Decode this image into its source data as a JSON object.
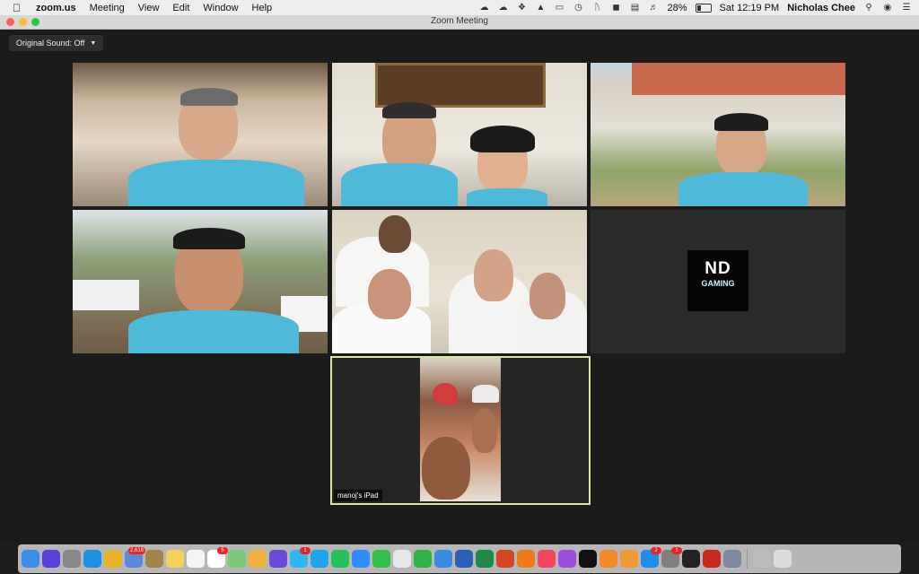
{
  "menubar": {
    "app_name": "zoom.us",
    "menus": [
      "Meeting",
      "View",
      "Edit",
      "Window",
      "Help"
    ],
    "battery": "28%",
    "clock": "Sat 12:19 PM",
    "user": "Nicholas Chee",
    "status_icons": [
      "creative-cloud-icon",
      "cloud-icon",
      "dropbox-icon",
      "backup-icon",
      "airplay-icon",
      "time-machine-icon",
      "bluetooth-icon",
      "wifi-icon",
      "display-icon",
      "volume-icon",
      "battery-icon",
      "search-icon",
      "siri-icon",
      "control-center-icon"
    ]
  },
  "window": {
    "title": "Zoom Meeting"
  },
  "zoom": {
    "sound_button": "Original Sound: Off",
    "active_speaker_name": "manoj's iPad",
    "logo_text": {
      "line1": "ND",
      "line2": "GAMING"
    }
  },
  "dock": {
    "apps": [
      {
        "name": "finder-icon",
        "color": "#3b8fe6",
        "badge": ""
      },
      {
        "name": "siri-icon",
        "color": "#5a3fd8",
        "badge": ""
      },
      {
        "name": "launchpad-icon",
        "color": "#888",
        "badge": ""
      },
      {
        "name": "safari-icon",
        "color": "#1e8fe0",
        "badge": ""
      },
      {
        "name": "chrome-icon",
        "color": "#e9b32a",
        "badge": ""
      },
      {
        "name": "preview-icon",
        "color": "#5b8ad8",
        "badge": "2,616"
      },
      {
        "name": "notes-icon",
        "color": "#a5844c",
        "badge": ""
      },
      {
        "name": "stickies-icon",
        "color": "#f2d25a",
        "badge": ""
      },
      {
        "name": "reminders-icon",
        "color": "#f4f4f4",
        "badge": ""
      },
      {
        "name": "calendar-icon",
        "color": "#ffffff",
        "badge": "5"
      },
      {
        "name": "maps-icon",
        "color": "#7fc77a",
        "badge": ""
      },
      {
        "name": "photos-icon",
        "color": "#f3b23c",
        "badge": ""
      },
      {
        "name": "imovie-icon",
        "color": "#6b4bd8",
        "badge": ""
      },
      {
        "name": "messages-icon",
        "color": "#2fb6f5",
        "badge": "1"
      },
      {
        "name": "skype-icon",
        "color": "#1ea6e8",
        "badge": ""
      },
      {
        "name": "whatsapp-icon",
        "color": "#25c25c",
        "badge": ""
      },
      {
        "name": "zoom-icon",
        "color": "#2d8cff",
        "badge": ""
      },
      {
        "name": "facetime-icon",
        "color": "#31c14b",
        "badge": ""
      },
      {
        "name": "textedit-icon",
        "color": "#e8e8e8",
        "badge": ""
      },
      {
        "name": "numbers-icon",
        "color": "#2fb24a",
        "badge": ""
      },
      {
        "name": "keynote-icon",
        "color": "#3a8be0",
        "badge": ""
      },
      {
        "name": "word-icon",
        "color": "#2b5fb9",
        "badge": ""
      },
      {
        "name": "excel-icon",
        "color": "#1f8a48",
        "badge": ""
      },
      {
        "name": "powerpoint-icon",
        "color": "#d24625",
        "badge": ""
      },
      {
        "name": "vlc-icon",
        "color": "#ee7a18",
        "badge": ""
      },
      {
        "name": "music-icon",
        "color": "#f2465e",
        "badge": ""
      },
      {
        "name": "podcasts-icon",
        "color": "#9b4ddb",
        "badge": ""
      },
      {
        "name": "apple-tv-icon",
        "color": "#111111",
        "badge": ""
      },
      {
        "name": "books-icon",
        "color": "#f08a2a",
        "badge": ""
      },
      {
        "name": "pages-icon",
        "color": "#f19a33",
        "badge": ""
      },
      {
        "name": "app-store-icon",
        "color": "#1f8ee8",
        "badge": "2"
      },
      {
        "name": "system-preferences-icon",
        "color": "#808080",
        "badge": "1"
      },
      {
        "name": "terminal-icon",
        "color": "#222222",
        "badge": ""
      },
      {
        "name": "acrobat-icon",
        "color": "#c72a1c",
        "badge": ""
      },
      {
        "name": "image-capture-icon",
        "color": "#7d8aa0",
        "badge": ""
      }
    ],
    "right": [
      {
        "name": "downloads-stack-icon",
        "color": "#bbbbbb",
        "badge": ""
      },
      {
        "name": "trash-icon",
        "color": "#dcdcdc",
        "badge": ""
      }
    ]
  }
}
